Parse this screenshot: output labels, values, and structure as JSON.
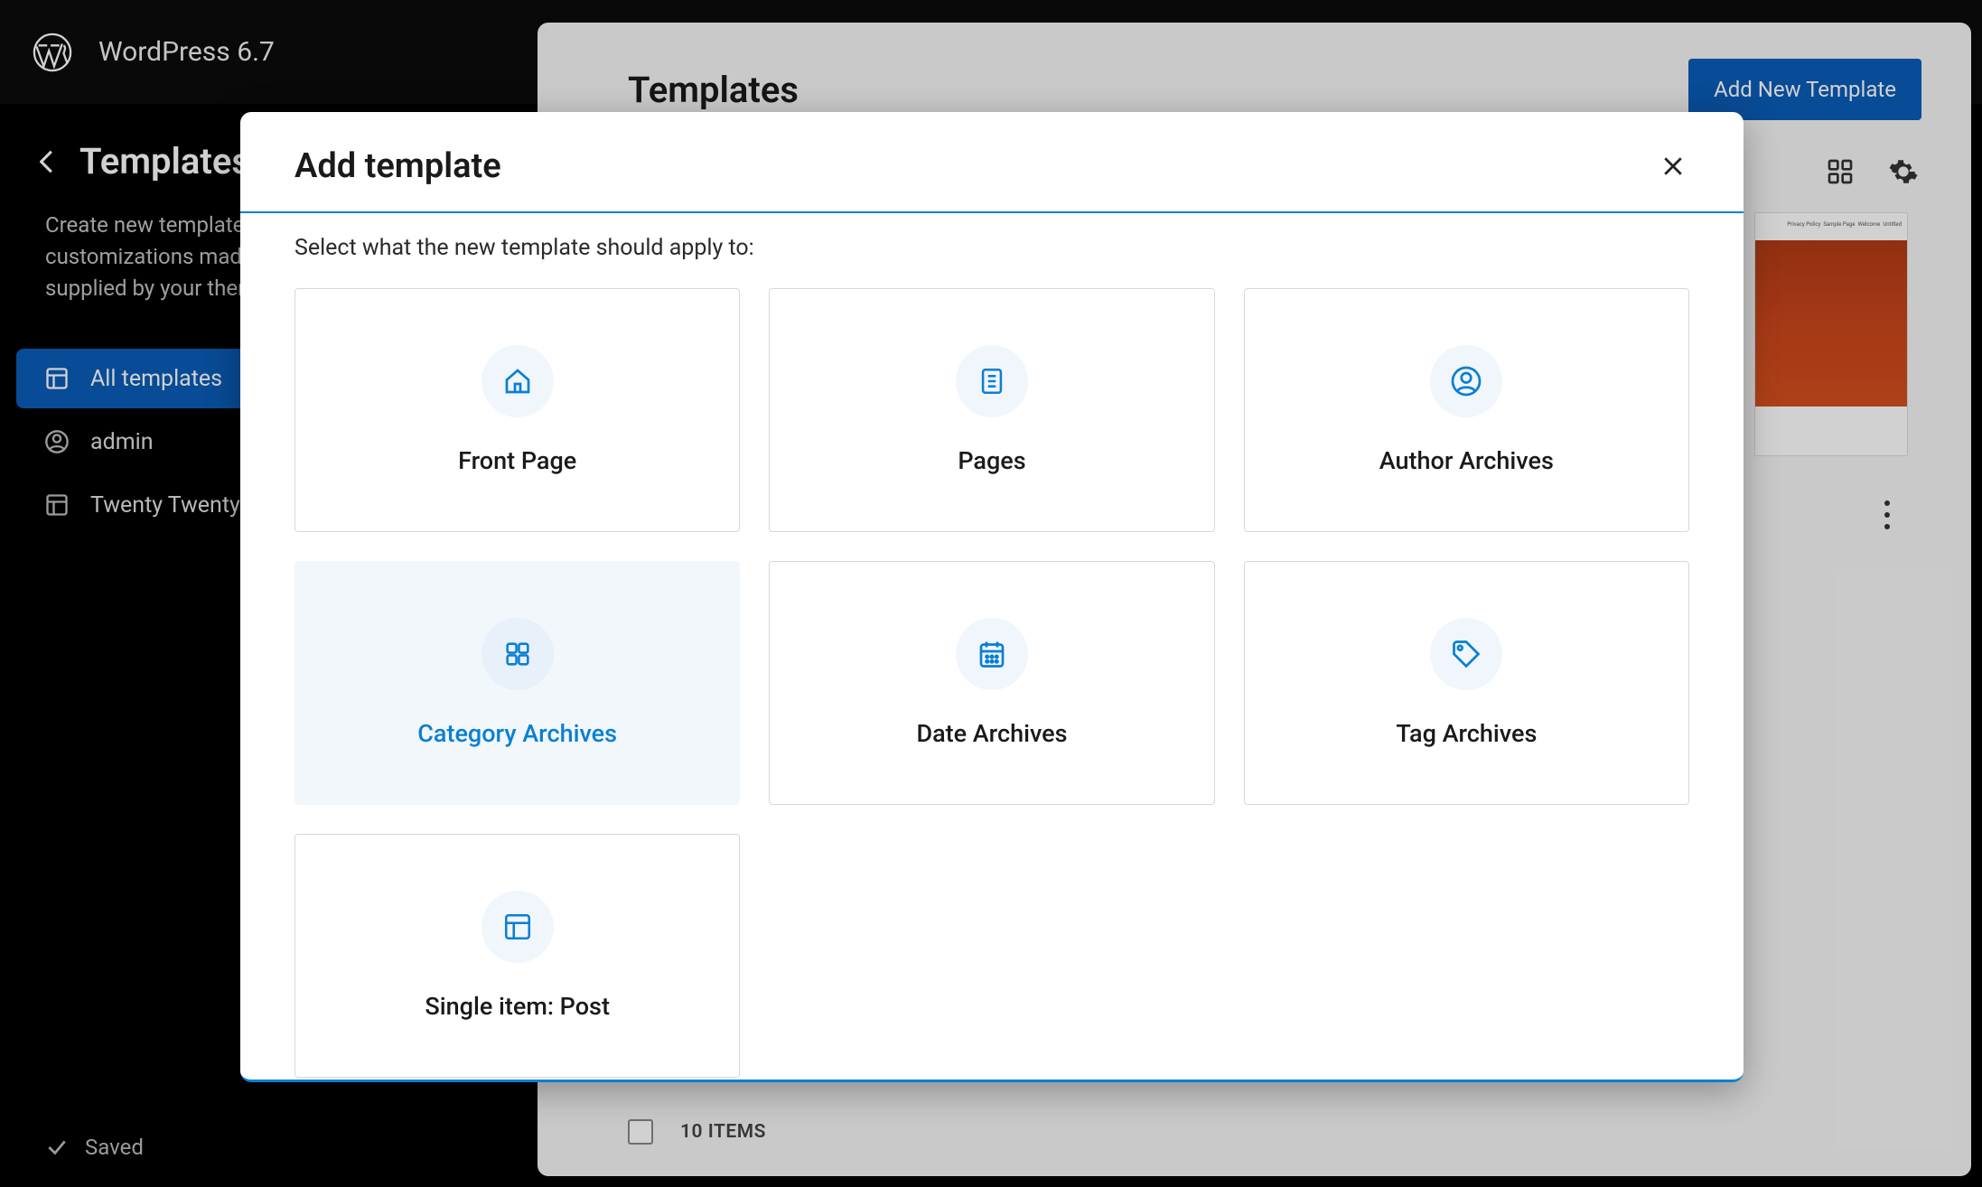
{
  "app": {
    "title": "WordPress 6.7"
  },
  "sidebar": {
    "title": "Templates",
    "description": "Create new templates, or reset any customizations made to the templates supplied by your theme.",
    "items": [
      {
        "label": "All templates",
        "icon": "layout"
      },
      {
        "label": "admin",
        "icon": "person"
      },
      {
        "label": "Twenty Twenty",
        "icon": "layout"
      }
    ]
  },
  "saved": {
    "label": "Saved"
  },
  "main": {
    "title": "Templates",
    "add_button": "Add New Template",
    "items_count": "10 ITEMS"
  },
  "modal": {
    "title": "Add template",
    "subtitle": "Select what the new template should apply to:",
    "cards": [
      {
        "label": "Front Page",
        "icon": "home"
      },
      {
        "label": "Pages",
        "icon": "page"
      },
      {
        "label": "Author Archives",
        "icon": "author"
      },
      {
        "label": "Category Archives",
        "icon": "grid"
      },
      {
        "label": "Date Archives",
        "icon": "calendar"
      },
      {
        "label": "Tag Archives",
        "icon": "tag"
      },
      {
        "label": "Single item: Post",
        "icon": "layout"
      }
    ],
    "hover_index": 3
  }
}
